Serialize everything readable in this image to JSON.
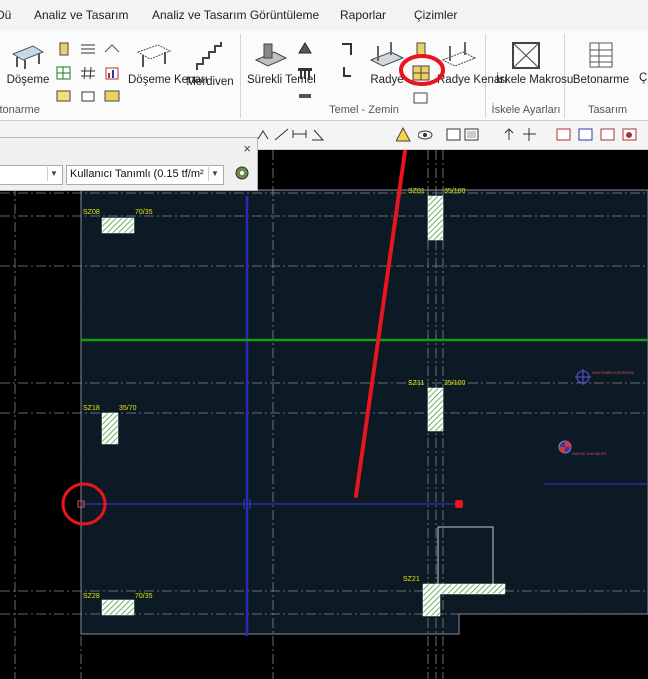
{
  "menu": [
    "Dü",
    "Analiz ve Tasarım",
    "Analiz ve Tasarım Görüntüleme",
    "Raporlar",
    "Çizimler"
  ],
  "ribbon": {
    "groups": [
      {
        "label": "Betonarme",
        "buttons": [
          "Döşeme",
          "Döşeme Kenarı",
          "Merdiven"
        ]
      },
      {
        "label": "Temel - Zemin",
        "buttons": [
          "Sürekli Temel",
          "Radye",
          "Radye Kenarı"
        ]
      },
      {
        "label": "İskele Ayarları",
        "buttons": [
          "İskele Makrosu"
        ]
      },
      {
        "label": "Tasarım",
        "buttons": [
          "Betonarme",
          "Ç"
        ]
      }
    ]
  },
  "property_panel": {
    "load_dropdown_value": "Kullanıcı Tanımlı (0.15 tf/m²",
    "close_symbol": "×"
  },
  "drawing": {
    "column_labels": [
      "SZ08",
      "SZ01",
      "SZ18",
      "SZ11",
      "SZ28",
      "SZ21"
    ],
    "column_sizes": [
      "70/35",
      "35/100",
      "35/70",
      "35/100",
      "70/35"
    ],
    "annotation_texts": [
      "RADYEMIN KATSAYISI",
      "RADYE KALINLIGI"
    ]
  },
  "annotations": {
    "highlight_color": "#e8141e",
    "radye_highlight": "circle around Radye tool icon",
    "corner_highlight": "circle around radye corner point"
  },
  "colors": {
    "drawing_background": "#0b1a24",
    "axis_blue": "#2a2ab8",
    "axis_green": "#1a9a1a",
    "label_yellow": "#e6e600",
    "hatch_green": "#2e9e2e"
  }
}
